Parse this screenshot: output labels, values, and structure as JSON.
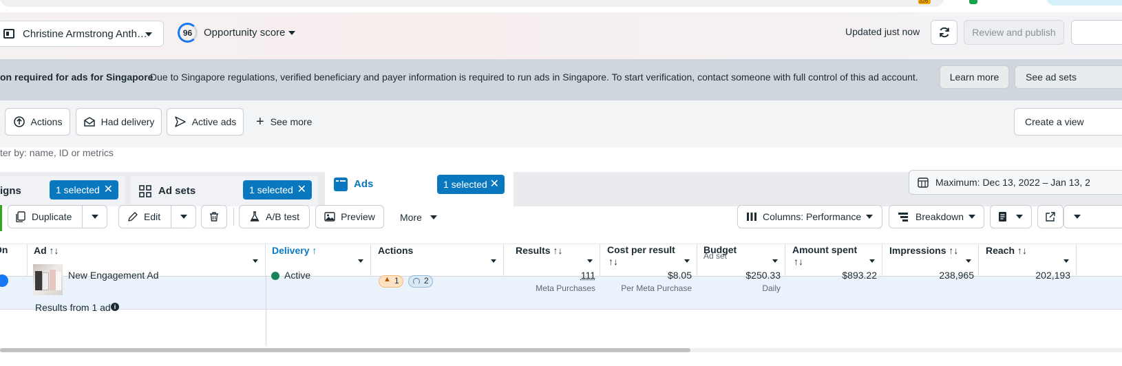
{
  "browser": {
    "badge": "326"
  },
  "header": {
    "account_name": "Christine Armstrong Anth…",
    "opportunity_score": "96",
    "opportunity_label": "Opportunity score",
    "updated_text": "Updated just now",
    "review_publish": "Review and publish"
  },
  "banner": {
    "title": "on required for ads for Singapore",
    "message": "Due to Singapore regulations, verified beneficiary and payer information is required to run ads in Singapore. To start verification, contact someone with full control of this ad account.",
    "learn_more": "Learn more",
    "see_ad_sets": "See ad sets"
  },
  "filters": {
    "actions": "Actions",
    "had_delivery": "Had delivery",
    "active_ads": "Active ads",
    "see_more": "See more",
    "create_view": "Create a view",
    "search_placeholder": "ter by: name, ID or metrics"
  },
  "tabs": {
    "campaigns": "igns",
    "campaigns_selected": "1 selected",
    "ad_sets": "Ad sets",
    "ad_sets_selected": "1 selected",
    "ads": "Ads",
    "ads_selected": "1 selected",
    "date_range": "Maximum: Dec 13, 2022 – Jan 13, 2"
  },
  "toolbar": {
    "duplicate": "Duplicate",
    "edit": "Edit",
    "ab_test": "A/B test",
    "preview": "Preview",
    "more": "More",
    "columns": "Columns: Performance",
    "breakdown": "Breakdown"
  },
  "table": {
    "headers": {
      "onoff": "On",
      "ad": "Ad ↑↓",
      "delivery": "Delivery ↑",
      "actions": "Actions",
      "results": "Results ↑↓",
      "cost_per_result": "Cost per result",
      "cost_sort": "↑↓",
      "budget": "Budget",
      "budget_sub": "Ad set",
      "amount_spent": "Amount spent",
      "amount_sort": "↑↓",
      "impressions": "Impressions ↑↓",
      "reach": "Reach ↑↓"
    },
    "row": {
      "ad_name": "New Engagement Ad",
      "delivery": "Active",
      "warn_count": "1",
      "info_count": "2",
      "results": "111",
      "results_sub": "Meta Purchases",
      "cost": "$8.05",
      "cost_sub": "Per Meta Purchase",
      "budget": "$250.33",
      "budget_sub": "Daily",
      "amount_spent": "$893.22",
      "impressions": "238,965",
      "reach": "202,193"
    },
    "footer": "Results from 1 ad"
  },
  "colors": {
    "accent": "#0a78be",
    "active_dot": "#17845a",
    "warning": "#b45309"
  }
}
